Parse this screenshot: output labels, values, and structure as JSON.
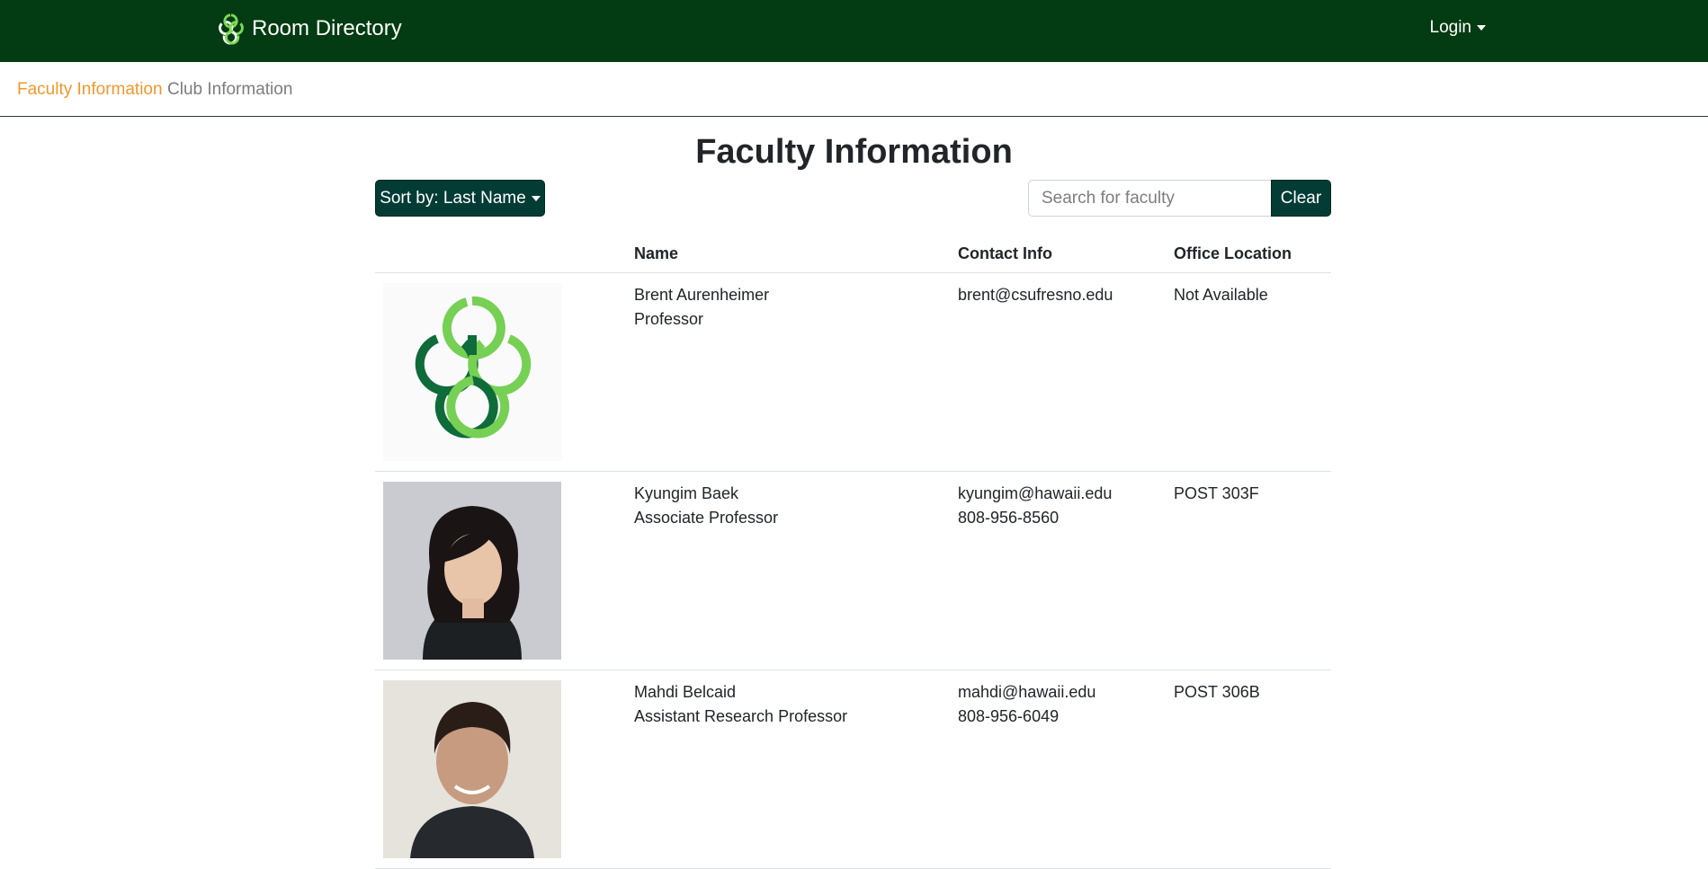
{
  "header": {
    "brand_title": "Room Directory",
    "brand_color": "#033c12",
    "login_label": "Login"
  },
  "subnav": {
    "items": [
      {
        "label": "Faculty Information",
        "active": true
      },
      {
        "label": "Club Information",
        "active": false
      }
    ],
    "active_color": "#f0982b"
  },
  "main": {
    "title": "Faculty Information",
    "sort_label": "Sort by: Last Name",
    "search": {
      "placeholder": "Search for faculty",
      "value": ""
    },
    "clear_label": "Clear",
    "columns": [
      "",
      "Name",
      "Contact Info",
      "Office Location"
    ],
    "rows": [
      {
        "photo": "placeholder-logo",
        "name": "Brent Aurenheimer",
        "title": "Professor",
        "email": "brent@csufresno.edu",
        "phone": "",
        "office": "Not Available"
      },
      {
        "photo": "portrait-woman",
        "name": "Kyungim Baek",
        "title": "Associate Professor",
        "email": "kyungim@hawaii.edu",
        "phone": "808-956-8560",
        "office": "POST 303F"
      },
      {
        "photo": "portrait-man",
        "name": "Mahdi Belcaid",
        "title": "Assistant Research Professor",
        "email": "mahdi@hawaii.edu",
        "phone": "808-956-6049",
        "office": "POST 306B"
      }
    ]
  }
}
